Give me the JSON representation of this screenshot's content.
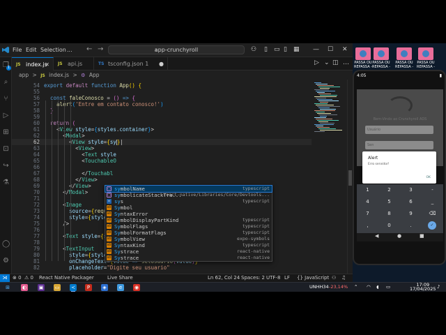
{
  "window": {
    "menu": [
      "File",
      "Edit",
      "Selection",
      "..."
    ],
    "command_center": "app-crunchyroll"
  },
  "tabs": [
    {
      "label": "index.js",
      "icon": "JS",
      "active": true,
      "has_close": true
    },
    {
      "label": "api.js",
      "icon": "JS",
      "active": false,
      "has_close": false
    },
    {
      "label": "tsconfig.json 1",
      "icon": "TS",
      "active": false,
      "has_close": false,
      "dirty": true
    }
  ],
  "breadcrumb": [
    "app",
    ">",
    "JS",
    "index.js",
    ">",
    "⚙",
    "App"
  ],
  "editor": {
    "current_line": 62,
    "lines": [
      {
        "n": "54",
        "html": "<span class='kw'>export</span> <span class='kw2'>default</span> <span class='kw'>function</span> <span class='fn'>App</span><span class='br1'>()</span> <span class='br1'>{</span>",
        "indent": 0
      },
      {
        "n": "55",
        "html": "",
        "indent": 0
      },
      {
        "n": "56",
        "html": "  <span class='kw'>const</span> <span class='fn'>faleConosco</span> <span class='op'>=</span> <span class='br2'>()</span> <span class='kw'>=&gt;</span> <span class='br2'>{</span>",
        "indent": 1
      },
      {
        "n": "57",
        "html": "    <span class='fn'>alert</span><span class='br3'>(</span><span class='str'>'Entre em contato conosco!'</span><span class='br3'>)</span>",
        "indent": 2
      },
      {
        "n": "58",
        "html": "  <span class='br2'>}</span>",
        "indent": 1
      },
      {
        "n": "59",
        "html": "",
        "indent": 0
      },
      {
        "n": "60",
        "html": "  <span class='kw2'>return</span> <span class='br2'>(</span>",
        "indent": 1
      },
      {
        "n": "61",
        "html": "    <span class='op'>&lt;</span><span class='comp'>View</span> <span class='attr'>style</span><span class='op'>=</span><span class='br3'>{</span><span class='var'>styles</span>.<span class='var'>container</span><span class='br3'>}</span><span class='op'>&gt;</span>",
        "indent": 2
      },
      {
        "n": "62",
        "html": "      <span class='op'>&lt;</span><span class='comp'>Modal</span><span class='op'>&gt;</span>",
        "indent": 3
      },
      {
        "n": "62",
        "html": "        <span class='op'>&lt;</span><span class='comp'>View</span> <span class='attr'>style</span><span class='op'>=</span><span class='br1'>{</span><span class='var'>sy</span><span class='cursor'></span><span class='br1'>}</span><span class='op'>|</span>",
        "indent": 4,
        "current": true
      },
      {
        "n": "63",
        "html": "          <span class='op'>&lt;</span><span class='comp'>View</span><span class='op'>&gt;</span>",
        "indent": 5
      },
      {
        "n": "64",
        "html": "            <span class='op'>&lt;</span><span class='comp'>Text</span> <span class='attr'>style</span>",
        "indent": 6
      },
      {
        "n": "65",
        "html": "            <span class='op'>&lt;</span><span class='comp'>TouchableO</span>",
        "indent": 6
      },
      {
        "n": "66",
        "html": "",
        "indent": 0
      },
      {
        "n": "67",
        "html": "            <span class='op'>&lt;/</span><span class='comp'>Touchabl</span>",
        "indent": 6
      },
      {
        "n": "68",
        "html": "          <span class='op'>&lt;/</span><span class='comp'>View</span><span class='op'>&gt;</span>",
        "indent": 5
      },
      {
        "n": "69",
        "html": "        <span class='op'>&lt;/</span><span class='comp'>View</span><span class='op'>&gt;</span>",
        "indent": 4
      },
      {
        "n": "70",
        "html": "      <span class='op'>&lt;/</span><span class='comp'>Modal</span><span class='op'>&gt;</span>",
        "indent": 3
      },
      {
        "n": "71",
        "html": "",
        "indent": 0
      },
      {
        "n": "72",
        "html": "      <span class='op'>&lt;</span><span class='comp'>Image</span>",
        "indent": 3
      },
      {
        "n": "73",
        "html": "        <span class='attr'>source</span><span class='op'>=</span><span class='br1'>{</span><span class='fn'>require</span>",
        "indent": 4
      },
      {
        "n": "74",
        "html": "        <span class='attr'>style</span><span class='op'>=</span><span class='br1'>{</span><span class='var'>styles</span>.<span class='var'>logo</span><span class='br1'>}</span>",
        "indent": 4
      },
      {
        "n": "75",
        "html": "      <span class='op'>/&gt;</span>",
        "indent": 3
      },
      {
        "n": "76",
        "html": "",
        "indent": 0
      },
      {
        "n": "77",
        "html": "      <span class='op'>&lt;</span><span class='comp'>Text</span> <span class='attr'>style</span><span class='op'>=</span><span class='br1'>{</span><span class='var'>styles</span>.<span class='var'>titulo</span><span class='br1'>}</span><span class='op'>&gt;</span><span class='txt'>Bem-Vindo ao Crunchyroll ADS</span><span class='op'>&lt;/</span><span class='comp'>Text</span><span class='op'>&gt;</span>",
        "indent": 3
      },
      {
        "n": "78",
        "html": "",
        "indent": 0
      },
      {
        "n": "79",
        "html": "      <span class='op'>&lt;</span><span class='comp'>TextInput</span>",
        "indent": 3
      },
      {
        "n": "80",
        "html": "        <span class='attr'>style</span><span class='op'>=</span><span class='br1'>{</span><span class='var'>styles</span>.<span class='var'>input</span><span class='br1'>}</span>",
        "indent": 4
      },
      {
        "n": "81",
        "html": "        <span class='attr'>onChangeText</span><span class='op'>=</span><span class='br1'>{</span><span class='var'>value</span> <span class='kw'>=&gt;</span> <span class='fn'>setUsuario</span><span class='br2'>(</span><span class='var'>value</span><span class='br2'>)</span><span class='br1'>}</span>",
        "indent": 4
      },
      {
        "n": "82",
        "html": "        <span class='attr'>placeholder</span><span class='op'>=</span><span class='str'>\"Digite seu usuario\"</span>",
        "indent": 4
      }
    ]
  },
  "suggestions": [
    {
      "kind": "method",
      "label": "symbolName",
      "detail": "typescript",
      "selected": true
    },
    {
      "kind": "method",
      "label": "symbolicateStackTra...",
      "detail": "react-native/Libraries/Core/Devtools..."
    },
    {
      "kind": "var",
      "label": "sys",
      "detail": "typescript"
    },
    {
      "kind": "sym",
      "label": "Symbol",
      "detail": ""
    },
    {
      "kind": "sym",
      "label": "SyntaxError",
      "detail": ""
    },
    {
      "kind": "sym",
      "label": "SymbolDisplayPartKind",
      "detail": "typescript"
    },
    {
      "kind": "sym",
      "label": "SymbolFlags",
      "detail": "typescript"
    },
    {
      "kind": "sym",
      "label": "SymbolFormatFlags",
      "detail": "typescript"
    },
    {
      "kind": "sym",
      "label": "SymbolView",
      "detail": "expo-symbols"
    },
    {
      "kind": "sym",
      "label": "SyntaxKind",
      "detail": "typescript"
    },
    {
      "kind": "sym",
      "label": "Systrace",
      "detail": "react-native"
    },
    {
      "kind": "sym",
      "label": "Systrace",
      "detail": "react-native"
    }
  ],
  "statusbar": {
    "errors": "⊗ 0",
    "warnings": "⚠ 0",
    "packager": "React Native Packager",
    "live_share": "Live Share",
    "position": "Ln 62, Col 24",
    "spaces": "Spaces: 2",
    "encoding": "UTF-8",
    "eol": "LF",
    "language": "{} JavaScript"
  },
  "thumbnails": [
    {
      "caption": "PASSA OU REPASSA -"
    },
    {
      "caption": "PASSA OU REPASSA -"
    },
    {
      "caption": "PASSA OU REPASSA -"
    },
    {
      "caption": "PASSA OU REPASSA -"
    }
  ],
  "phone": {
    "time": "4:05",
    "title": "Bem-Vindo ao Crunchyroll ADS",
    "user_placeholder": "Usuário",
    "pass_placeholder": "Sen",
    "alert_title": "Alert",
    "alert_message": "Erro servidor!",
    "alert_ok": "OK",
    "keys": [
      "1",
      "2",
      "3",
      "-",
      "4",
      "5",
      "6",
      "_",
      "7",
      "8",
      "9",
      "⌫",
      ",",
      "0",
      ".",
      "✓"
    ],
    "nav": [
      "◀",
      "●",
      "■"
    ]
  },
  "taskbar": {
    "stock": "UNHH34",
    "stock_change": "-23,14%",
    "time": "17:09",
    "date": "17/04/2025"
  },
  "colors": {
    "accent": "#0078d4",
    "editor_bg": "#1f1f1f",
    "suggest_selected": "#04395e"
  }
}
